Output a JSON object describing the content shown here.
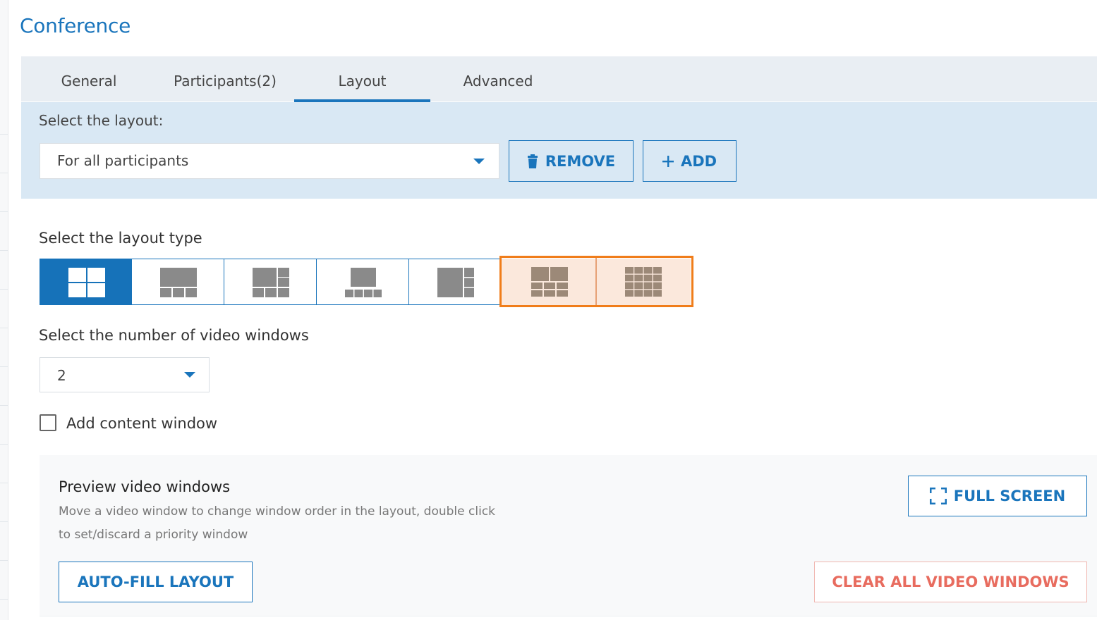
{
  "page": {
    "title": "Conference"
  },
  "tabs": [
    {
      "label": "General",
      "active": false
    },
    {
      "label": "Participants(2)",
      "active": true
    },
    {
      "label": "Layout",
      "active": true
    },
    {
      "label": "Advanced",
      "active": false
    }
  ],
  "layout_select": {
    "label": "Select the layout:",
    "value": "For all participants",
    "remove_label": "REMOVE",
    "add_label": "ADD",
    "remove_icon": "trash-icon",
    "add_icon": "plus-icon"
  },
  "layout_type": {
    "label": "Select the layout type",
    "options": [
      {
        "name": "grid-2x2",
        "selected": true
      },
      {
        "name": "one-big-three-small",
        "selected": false
      },
      {
        "name": "one-big-five-small",
        "selected": false
      },
      {
        "name": "one-center-four-small",
        "selected": false
      },
      {
        "name": "one-big-side-three",
        "selected": false
      },
      {
        "name": "two-top-six-bottom",
        "highlighted": true
      },
      {
        "name": "grid-4x4",
        "highlighted": true
      }
    ]
  },
  "video_windows": {
    "label": "Select the number of video windows",
    "value": "2"
  },
  "content_window": {
    "label": "Add content window",
    "checked": false
  },
  "preview": {
    "title": "Preview video windows",
    "description": "Move a video window to change window order in the layout, double click to set/discard a priority window",
    "full_screen_label": "FULL SCREEN",
    "full_screen_icon": "expand-icon",
    "auto_fill_label": "AUTO-FILL LAYOUT",
    "clear_all_label": "CLEAR ALL VIDEO WINDOWS"
  },
  "colors": {
    "accent": "#1a75bc",
    "highlight": "#f07d1a",
    "danger": "#e86c5f",
    "layout_icon_gray": "#8a8a8a",
    "layout_icon_brown": "#9c8978"
  }
}
